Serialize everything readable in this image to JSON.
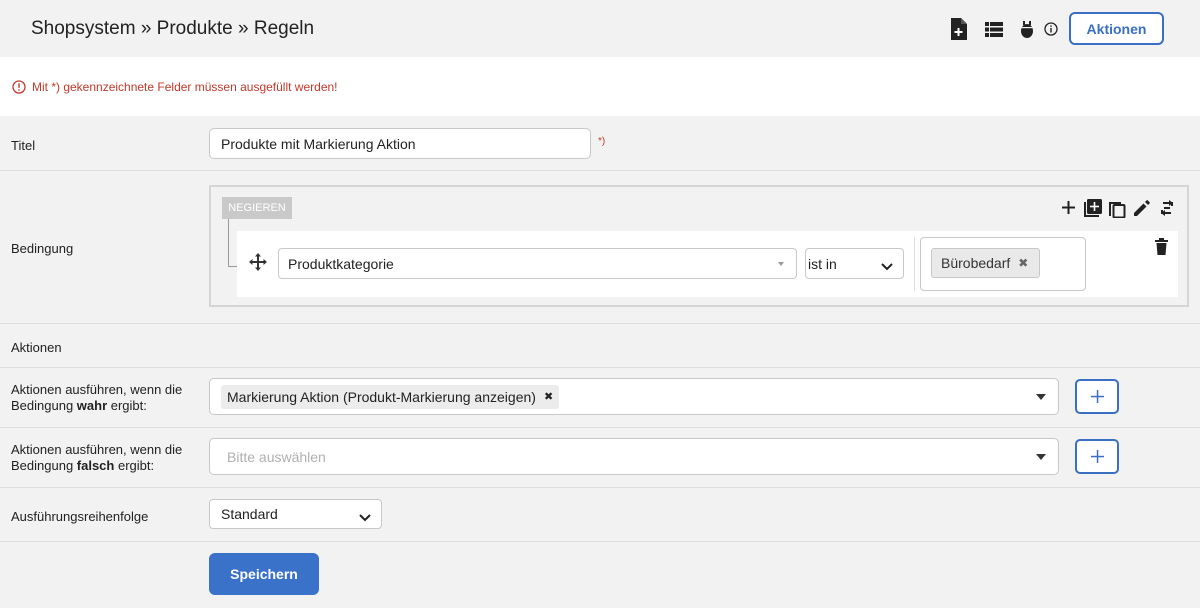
{
  "header": {
    "title": "Shopsystem » Produkte » Regeln",
    "actions_button": "Aktionen",
    "icons": [
      "file-plus-icon",
      "list-icon",
      "bug-icon",
      "info-icon"
    ]
  },
  "notice": {
    "text": "Mit *) gekennzeichnete Felder müssen ausgefüllt werden!"
  },
  "form": {
    "title_label": "Titel",
    "title_value": "Produkte mit Markierung Aktion",
    "required_marker": "*)",
    "condition_label": "Bedingung",
    "negate_label": "NEGIEREN",
    "condition_toolbar": [
      "plus-icon",
      "add-box-icon",
      "copy-icon",
      "edit-icon",
      "swap-icon"
    ],
    "rule": {
      "field": "Produktkategorie",
      "operator": "ist in",
      "values": [
        "Bürobedarf"
      ]
    },
    "actions_section": "Aktionen",
    "true_label_prefix": "Aktionen ausführen, wenn die Bedingung ",
    "true_label_bold": "wahr",
    "label_suffix": " ergibt:",
    "true_actions": [
      "Markierung Aktion (Produkt-Markierung anzeigen)"
    ],
    "false_label_prefix": "Aktionen ausführen, wenn die Bedingung ",
    "false_label_bold": "falsch",
    "false_placeholder": "Bitte auswählen",
    "order_label": "Ausführungsreihenfolge",
    "order_value": "Standard",
    "save_button": "Speichern"
  },
  "colors": {
    "accent": "#3a6fc4",
    "error": "#c0392b",
    "background": "#f2f2f2"
  }
}
